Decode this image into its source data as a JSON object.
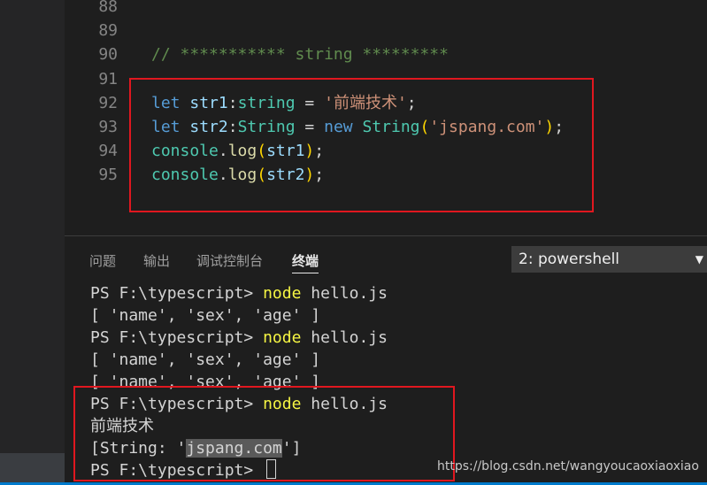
{
  "editor": {
    "lines": [
      {
        "number": "88",
        "tokens": []
      },
      {
        "number": "89",
        "tokens": []
      },
      {
        "number": "90",
        "tokens": [
          {
            "t": "// *********** string *********",
            "c": "cmt"
          }
        ]
      },
      {
        "number": "91",
        "tokens": []
      },
      {
        "number": "92",
        "tokens": [
          {
            "t": "let",
            "c": "kw"
          },
          {
            "t": " ",
            "c": "punc"
          },
          {
            "t": "str1",
            "c": "var"
          },
          {
            "t": ":",
            "c": "punc"
          },
          {
            "t": "string",
            "c": "type"
          },
          {
            "t": " = ",
            "c": "punc"
          },
          {
            "t": "'前端技术'",
            "c": "str"
          },
          {
            "t": ";",
            "c": "punc"
          }
        ]
      },
      {
        "number": "93",
        "tokens": [
          {
            "t": "let",
            "c": "kw"
          },
          {
            "t": " ",
            "c": "punc"
          },
          {
            "t": "str2",
            "c": "var"
          },
          {
            "t": ":",
            "c": "punc"
          },
          {
            "t": "String",
            "c": "type"
          },
          {
            "t": " = ",
            "c": "punc"
          },
          {
            "t": "new",
            "c": "kw"
          },
          {
            "t": " ",
            "c": "punc"
          },
          {
            "t": "String",
            "c": "type"
          },
          {
            "t": "(",
            "c": "paren"
          },
          {
            "t": "'jspang.com'",
            "c": "str"
          },
          {
            "t": ")",
            "c": "paren"
          },
          {
            "t": ";",
            "c": "punc"
          }
        ]
      },
      {
        "number": "94",
        "tokens": [
          {
            "t": "console",
            "c": "type"
          },
          {
            "t": ".",
            "c": "punc"
          },
          {
            "t": "log",
            "c": "fn"
          },
          {
            "t": "(",
            "c": "paren"
          },
          {
            "t": "str1",
            "c": "var"
          },
          {
            "t": ")",
            "c": "paren"
          },
          {
            "t": ";",
            "c": "punc"
          }
        ]
      },
      {
        "number": "95",
        "tokens": [
          {
            "t": "console",
            "c": "type"
          },
          {
            "t": ".",
            "c": "punc"
          },
          {
            "t": "log",
            "c": "fn"
          },
          {
            "t": "(",
            "c": "paren"
          },
          {
            "t": "str2",
            "c": "var"
          },
          {
            "t": ")",
            "c": "paren"
          },
          {
            "t": ";",
            "c": "punc"
          }
        ]
      }
    ]
  },
  "panel": {
    "tabs": [
      {
        "label": "问题",
        "active": false
      },
      {
        "label": "输出",
        "active": false
      },
      {
        "label": "调试控制台",
        "active": false
      },
      {
        "label": "终端",
        "active": true
      }
    ],
    "terminal_select": "2: powershell"
  },
  "terminal": {
    "lines": [
      {
        "prompt": "PS F:\\typescript> ",
        "cmd": "node",
        "rest": " hello.js"
      },
      {
        "text": "[ 'name', 'sex', 'age' ]"
      },
      {
        "prompt": "PS F:\\typescript> ",
        "cmd": "node",
        "rest": " hello.js"
      },
      {
        "text": "[ 'name', 'sex', 'age' ]"
      },
      {
        "text": "[ 'name', 'sex', 'age' ]"
      },
      {
        "prompt": "PS F:\\typescript> ",
        "cmd": "node",
        "rest": " hello.js"
      },
      {
        "text": "前端技术"
      },
      {
        "before": "[String: '",
        "selected": "jspang.com",
        "after": "']"
      },
      {
        "prompt": "PS F:\\typescript> ",
        "cursor": true
      }
    ]
  },
  "watermark": "https://blog.csdn.net/wangyoucaoxiaoxiao",
  "colors": {
    "highlight_box": "#e0171f",
    "status_bar": "#007acc"
  }
}
